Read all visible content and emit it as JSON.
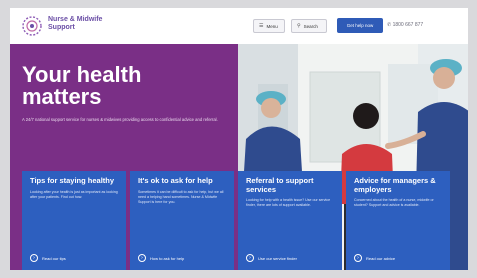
{
  "brand": {
    "line1": "Nurse & Midwife",
    "line2": "Support"
  },
  "header": {
    "menu_label": "Menu",
    "search_label": "Search",
    "cta_label": "Get help now",
    "phone": "1800 667 877"
  },
  "hero": {
    "title_line1": "Your health",
    "title_line2": "matters",
    "subtitle": "A 24/7 national support service for nurses & midwives providing access to confidential advice and referral."
  },
  "cards": [
    {
      "title": "Tips for staying healthy",
      "body": "Looking after your health is just as important as looking after your patients. Find out how.",
      "link": "Read our tips"
    },
    {
      "title": "It's ok to ask for help",
      "body": "Sometimes it can be difficult to ask for help, but we all need a helping hand sometimes. Nurse & Midwife Support is here for you.",
      "link": "How to ask for help"
    },
    {
      "title": "Referral to support services",
      "body": "Looking for help with a health issue? Use our service finder, there are lots of support available.",
      "link": "Use our service finder"
    },
    {
      "title": "Advice for managers & employers",
      "body": "Concerned about the health of a nurse, midwife or student? Support and advice is available.",
      "link": "Read our advice"
    }
  ],
  "colors": {
    "purple": "#7a2f86",
    "blue": "#2d5fbf",
    "cta": "#2f5bb7"
  }
}
